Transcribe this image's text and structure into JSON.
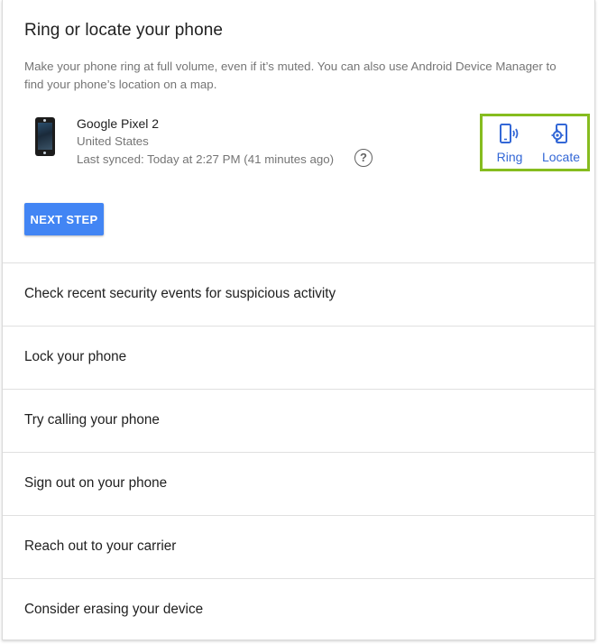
{
  "card": {
    "title": "Ring or locate your phone",
    "description": "Make your phone ring at full volume, even if it’s muted. You can also use Android Device Manager to find your phone’s location on a map.",
    "device": {
      "name": "Google Pixel 2",
      "country": "United States",
      "last_synced": "Last synced: Today at 2:27 PM (41 minutes ago)",
      "help_glyph": "?"
    },
    "actions": {
      "ring_label": "Ring",
      "ring_icon": "phone-ring-icon",
      "locate_label": "Locate",
      "locate_icon": "phone-locate-icon"
    },
    "next_step_label": "NEXT STEP"
  },
  "rows": [
    {
      "label": "Check recent security events for suspicious activity"
    },
    {
      "label": "Lock your phone"
    },
    {
      "label": "Try calling your phone"
    },
    {
      "label": "Sign out on your phone"
    },
    {
      "label": "Reach out to your carrier"
    },
    {
      "label": "Consider erasing your device"
    }
  ],
  "colors": {
    "accent_blue": "#4285f4",
    "link_blue": "#3367d6",
    "highlight_green": "#86bc1f",
    "divider": "#e0e0e0",
    "secondary_text": "#757575"
  }
}
